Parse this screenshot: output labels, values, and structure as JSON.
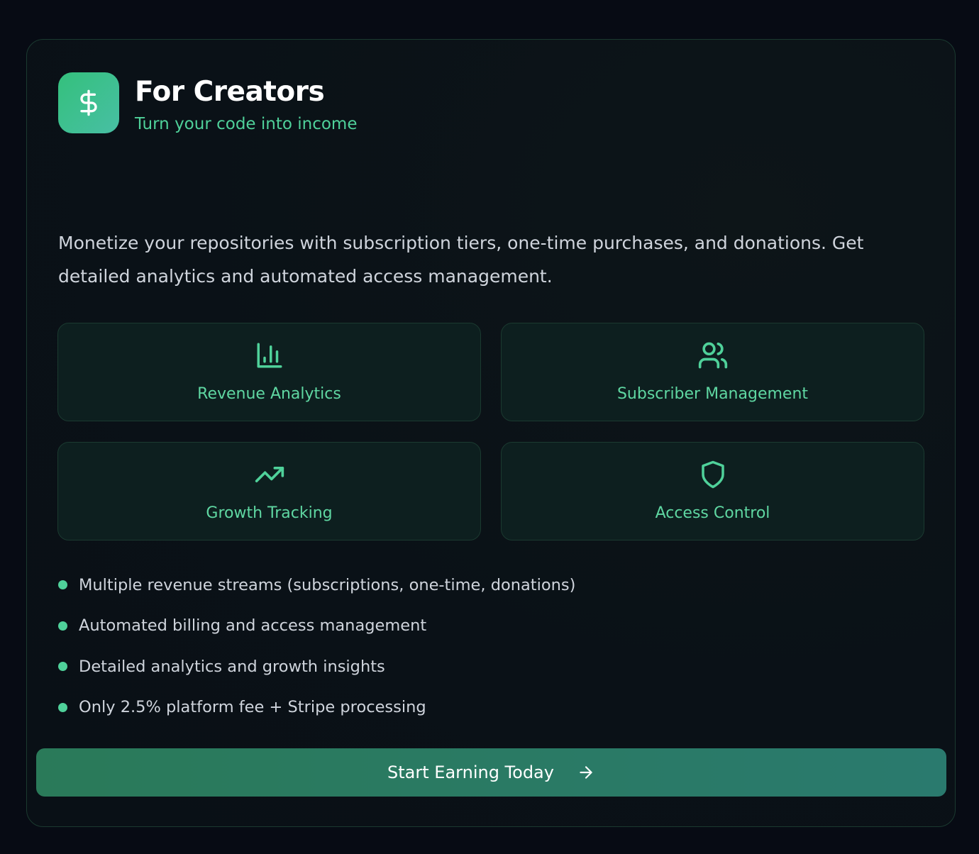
{
  "header": {
    "icon": "dollar-icon",
    "title": "For Creators",
    "subtitle": "Turn your code into income"
  },
  "description": "Monetize your repositories with subscription tiers, one-time purchases, and donations. Get detailed analytics and automated access management.",
  "features": [
    {
      "icon": "bar-chart-icon",
      "label": "Revenue Analytics"
    },
    {
      "icon": "users-icon",
      "label": "Subscriber Management"
    },
    {
      "icon": "trending-up-icon",
      "label": "Growth Tracking"
    },
    {
      "icon": "shield-icon",
      "label": "Access Control"
    }
  ],
  "bullets": [
    "Multiple revenue streams (subscriptions, one-time, donations)",
    "Automated billing and access management",
    "Detailed analytics and growth insights",
    "Only 2.5% platform fee + Stripe processing"
  ],
  "cta": {
    "label": "Start Earning Today",
    "icon": "arrow-right-icon"
  },
  "colors": {
    "background": "#070b14",
    "accent": "#4fd19a",
    "card_border": "#1b3a30",
    "cta_gradient_start": "#2a7a59",
    "cta_gradient_end": "#2a7a6e"
  }
}
